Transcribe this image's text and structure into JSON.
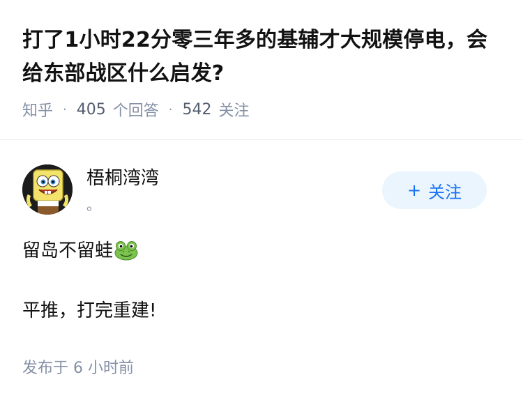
{
  "question": {
    "title": "打了1小时22分零三年多的基辅才大规模停电，会给东部战区什么启发?",
    "source": "知乎",
    "answer_count": "405",
    "answer_label": "个回答",
    "follower_count": "542",
    "follower_label": "关注",
    "separator": "·"
  },
  "answer": {
    "author_name": "梧桐湾湾",
    "author_bio": "。",
    "follow_button": {
      "plus": "+",
      "label": "关注"
    },
    "paragraphs": [
      "留岛不留蛙",
      "平推，打完重建!"
    ],
    "emoji_icon": "frog-face-icon",
    "publish_time": "发布于  6 小时前"
  },
  "colors": {
    "muted": "#8590a6",
    "accent": "#1772f6",
    "button_bg": "#ebf5fd"
  }
}
